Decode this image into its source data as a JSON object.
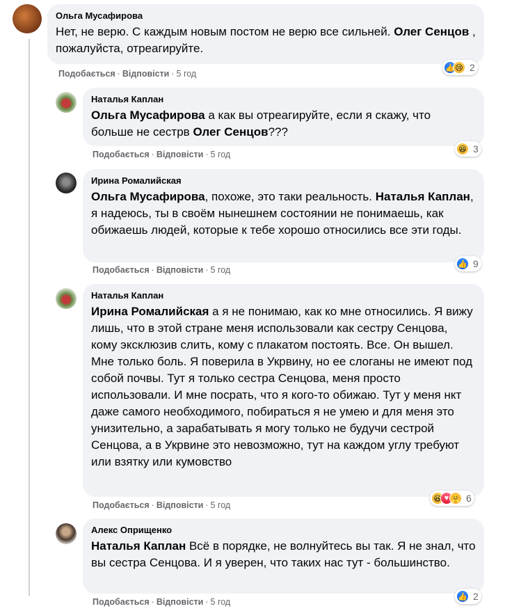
{
  "actions": {
    "like": "Подобається",
    "reply": "Відповісти"
  },
  "comments": [
    {
      "author": "Ольга Мусафирова",
      "segments": [
        "Нет, не верю. С каждым новым постом не верю все сильней. ",
        "Олег Сенцов",
        " , пожалуйста, отреагируйте."
      ],
      "time": "5 год",
      "reactions": [
        "like-icon",
        "sad-icon"
      ],
      "count": "2"
    },
    {
      "author": "Наталья Каплан",
      "segments": [
        "",
        "Ольга Мусафирова",
        " а как вы отреагируйте, если я скажу, что больше не сестрв ",
        "Олег Сенцов",
        "???"
      ],
      "time": "5 год",
      "reactions": [
        "haha-icon"
      ],
      "count": "3"
    },
    {
      "author": "Ирина Ромалийская",
      "segments": [
        "",
        "Ольга Мусафирова",
        ", похоже, это таки реальность. ",
        "Наталья Каплан",
        ", я надеюсь, ты в своём нынешнем состоянии не понимаешь, как обижаешь людей, которые к тебе хорошо относились все эти годы."
      ],
      "time": "5 год",
      "reactions": [
        "like-icon"
      ],
      "count": "9"
    },
    {
      "author": "Наталья Каплан",
      "segments": [
        "",
        "Ирина Ромалийская",
        " а я не понимаю, как ко мне относились. Я вижу лишь, что в этой стране меня использовали как сестру Сенцова, кому эксклюзив слить, кому с плакатом постоять. Все. Он вышел. Мне только боль. Я поверила в Укрвину, но ее слоганы не имеют под собой почвы. Тут я только сестра Сенцова, меня просто использовали. И мне посрать, что я кого-то обижаю. Тут у меня нкт даже самого необходимого, побираться я не умею и для меня это унизительно, а зарабатывать я могу только не будучи сестрой Сенцова, а в Укрвине это невозможно, тут на каждом углу требуют или взятку или кумовство"
      ],
      "time": "5 год",
      "reactions": [
        "haha-icon",
        "love-icon",
        "care-icon"
      ],
      "count": "6"
    },
    {
      "author": "Алекс Оприщенко",
      "segments": [
        "",
        "Наталья Каплан",
        " Всё в порядке, не волнуйтесь вы так. Я не знал, что вы сестра Сенцова. И я уверен, что таких нас тут - большинство."
      ],
      "time": "5 год",
      "reactions": [
        "like-icon"
      ],
      "count": "2"
    }
  ],
  "colors": {
    "bubble": "#f0f2f5",
    "secondary_text": "#65676b",
    "like_blue": "#1877f2"
  }
}
